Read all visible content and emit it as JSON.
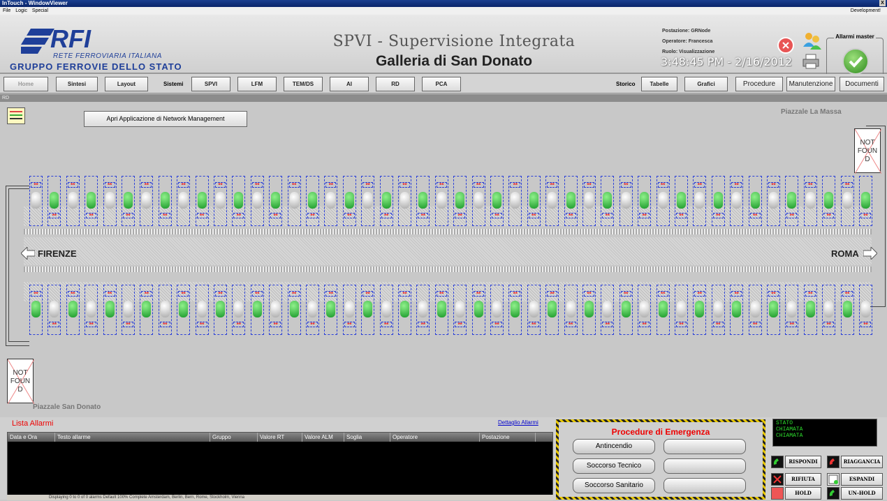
{
  "window": {
    "title": "InTouch - WindowViewer",
    "close_label": "X"
  },
  "menu": {
    "items": [
      "File",
      "Logic",
      "Special"
    ],
    "right": "Development!"
  },
  "header": {
    "logo_rfi": "RFI",
    "logo_rete": "RETE FERROVIARIA ITALIANA",
    "logo_gruppo": "GRUPPO FERROVIE DELLO STATO",
    "title": "SPVI - Supervisione Integrata",
    "subtitle": "Galleria di San Donato",
    "postazione": "Postazione: GRNode",
    "operatore": "Operatore: Francesca",
    "ruolo": "Ruolo: Visualizzazione",
    "clock": "3:48:45 PM - 2/16/2012",
    "alarm_master_label": "Allarmi master"
  },
  "nav": {
    "home": "Home",
    "sintesi": "Sintesi",
    "layout": "Layout",
    "sistemi_label": "Sistemi",
    "spvi": "SPVI",
    "lfm": "LFM",
    "temds": "TEM/DS",
    "ai": "AI",
    "rd": "RD",
    "pca": "PCA",
    "storico_label": "Storico",
    "tabelle": "Tabelle",
    "grafici": "Grafici",
    "procedure": "Procedure",
    "manutenzione": "Manutenzione",
    "documenti": "Documenti"
  },
  "section": "RD",
  "main": {
    "net_button": "Apri Applicazione di Network Management",
    "place_top": "Piazzale La Massa",
    "place_bottom": "Piazzale San Donato",
    "not_found_line1": "NOT",
    "not_found_line2": "FOUN",
    "not_found_line3": "D",
    "dir_left": "FIRENZE",
    "dir_right": "ROMA",
    "asterisks": "**"
  },
  "alarms": {
    "title": "Lista Allarmi",
    "detail_link": "Dettaglio Allarmi",
    "columns": [
      "Data e Ora",
      "Testo allarme",
      "Gruppo",
      "Valore RT",
      "Valore ALM",
      "Soglia",
      "Operatore",
      "Postazione"
    ],
    "status": "Displaying 0 to 0 of 0 alarms   Default   100% Complete   Amsterdam, Berlin, Bern, Rome, Stockholm, Vienna"
  },
  "procedures": {
    "title": "Procedure di Emergenza",
    "buttons": [
      "Antincendio",
      "Soccorso Tecnico",
      "Soccorso Sanitario"
    ]
  },
  "call": {
    "stato": "STATO",
    "chiamata1": "CHIAMATA",
    "chiamata2": "CHIAMATA",
    "rispondi": "RISPONDI",
    "riaggancia": "RIAGGANCIA",
    "rifiuta": "RIFIUTA",
    "espandi": "ESPANDI",
    "hold": "HOLD",
    "unhold": "UN-HOLD"
  }
}
